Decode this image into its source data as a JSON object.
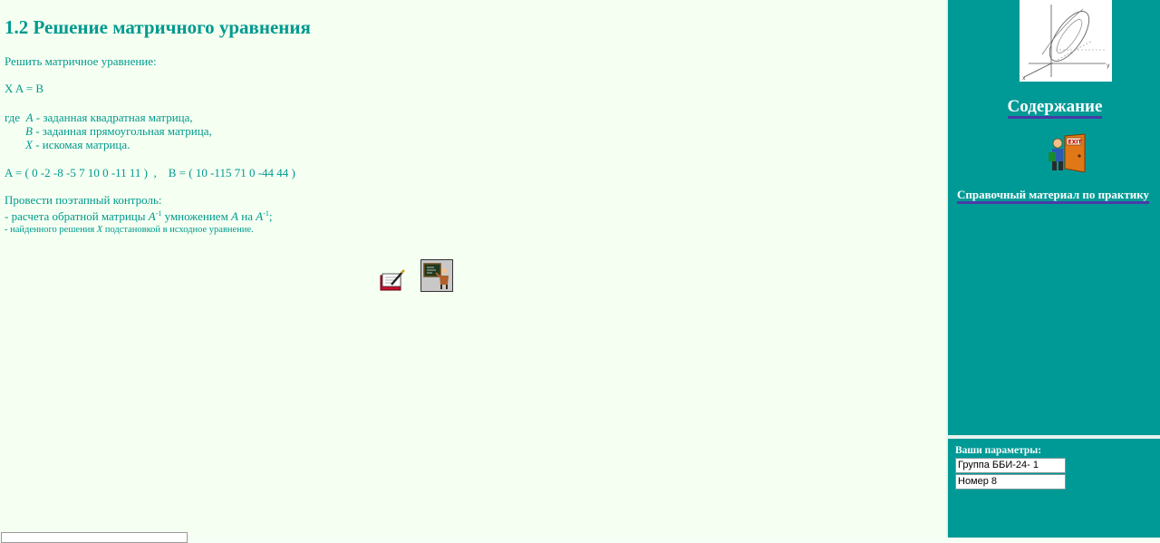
{
  "main": {
    "title": "1.2 Решение матричного уравнения",
    "intro": "Решить матричное уравнение:",
    "equation": "X  A = B",
    "where_prefix": "где ",
    "where_A_var": "A",
    "where_A_text": " - заданная квадратная матрица,",
    "where_B_var": "B",
    "where_B_text": " - заданная прямоугольная матрица,",
    "where_X_var": "X",
    "where_X_text": " - искомая матрица.",
    "matrix_A": "A = ( 0 -2 -8 -5 7 10 0 -11 11 )",
    "matrix_sep": "  ,    ",
    "matrix_B": "B = ( 10 -115 71 0 -44 44 )",
    "control_heading": "Провести поэтапный контроль:",
    "control_1_a": "- расчета обратной матрицы ",
    "control_1_var1": "A",
    "control_1_sup1": "-1",
    "control_1_b": " умножением ",
    "control_1_var2": "A",
    "control_1_c": " на ",
    "control_1_var3": "A",
    "control_1_sup2": "-1",
    "control_1_d": ";",
    "control_2_a": "- найденного решения ",
    "control_2_var": "X",
    "control_2_b": " подстановкой в исходное уравнение.",
    "tools": [
      "notebook-pen-icon",
      "teacher-blackboard-icon"
    ]
  },
  "sidebar": {
    "contents_link": "Содержание",
    "exit_icon": "exit-door-icon",
    "reference_link": "Справочный материал по практику",
    "params_label": "Ваши параметры:",
    "group_value": "Группа ББИ-24- 1",
    "number_value": "Номер 8"
  },
  "colors": {
    "accent": "#009a8e",
    "sidebar_bg": "#009a96",
    "page_bg": "#f5fff2",
    "link_underline": "#4a3aa8"
  }
}
